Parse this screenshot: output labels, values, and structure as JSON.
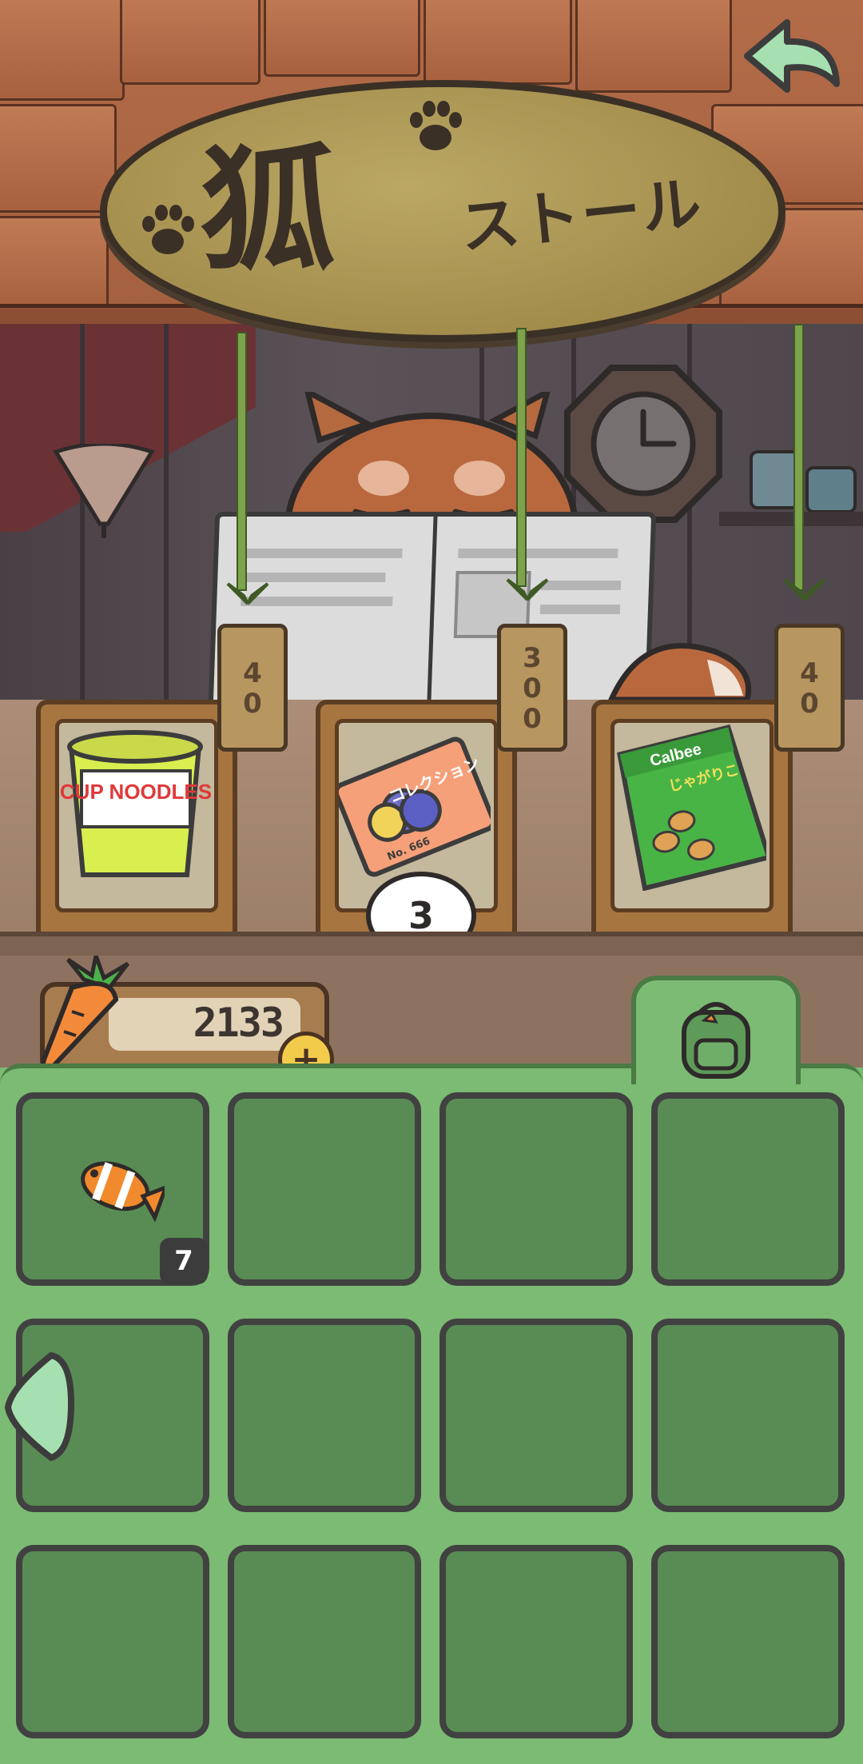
{
  "sign": {
    "kanji": "狐",
    "kana": "ストール"
  },
  "shop": {
    "items": [
      {
        "name": "cup-noodles",
        "label": "CUP NOODLES",
        "price": "40"
      },
      {
        "name": "collection-ticket",
        "label": "コレクション",
        "subtext": "No. 666",
        "price": "300"
      },
      {
        "name": "jagarico-snack",
        "label": "Calbee",
        "subtext": "じゃがりこ",
        "price": "40"
      }
    ],
    "stock": "3"
  },
  "currency": {
    "amount": "2133"
  },
  "inventory": {
    "slots": [
      {
        "item": "clownfish",
        "count": "7"
      },
      {},
      {},
      {},
      {},
      {},
      {},
      {},
      {},
      {},
      {},
      {}
    ]
  },
  "colors": {
    "inventory_bg": "#7bbb73",
    "slot_bg": "#588c54",
    "roof": "#b36c48",
    "sign": "#a08b4a"
  }
}
